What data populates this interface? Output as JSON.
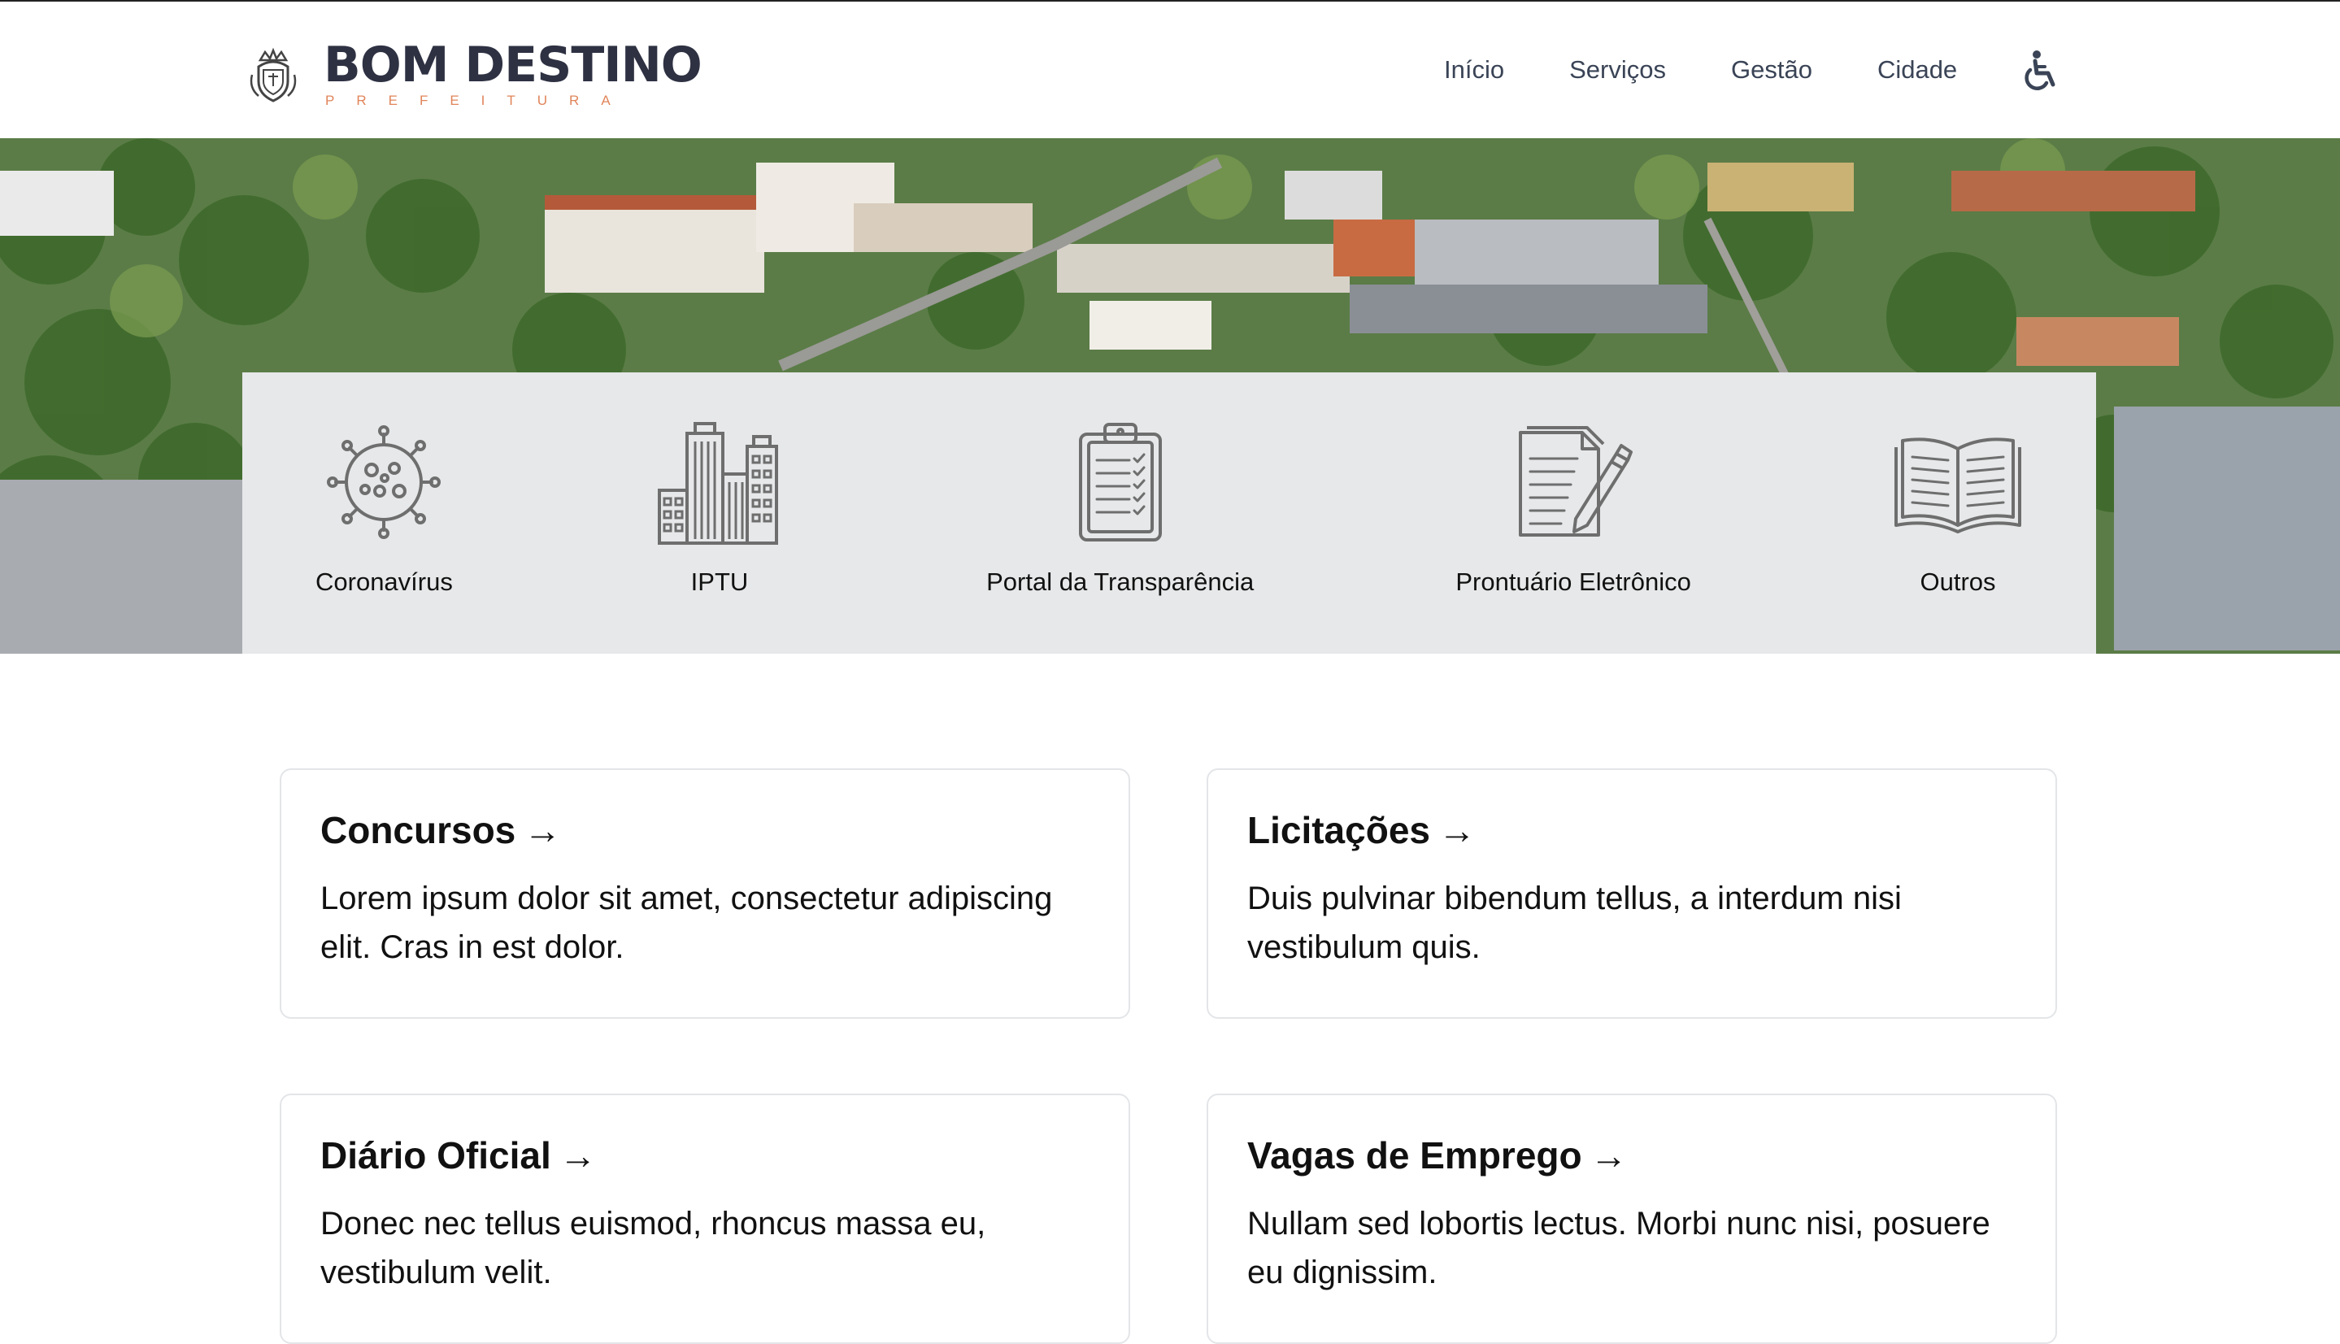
{
  "header": {
    "brand_name": "BOM DESTINO",
    "brand_sub": "PREFEITURA",
    "nav": [
      {
        "label": "Início"
      },
      {
        "label": "Serviços"
      },
      {
        "label": "Gestão"
      },
      {
        "label": "Cidade"
      }
    ],
    "accessibility_icon": "wheelchair-icon",
    "logo_icon": "crest-icon"
  },
  "hero": {
    "image": "aerial-city-photo"
  },
  "services": [
    {
      "label": "Coronavírus",
      "icon": "virus-icon"
    },
    {
      "label": "IPTU",
      "icon": "buildings-icon"
    },
    {
      "label": "Portal da Transparência",
      "icon": "clipboard-checklist-icon"
    },
    {
      "label": "Prontuário Eletrônico",
      "icon": "document-pen-icon"
    },
    {
      "label": "Outros",
      "icon": "open-book-icon"
    }
  ],
  "cards": [
    {
      "title": "Concursos",
      "arrow": "→",
      "text": "Lorem ipsum dolor sit amet, consectetur adipiscing elit. Cras in est dolor."
    },
    {
      "title": "Licitações",
      "arrow": "→",
      "text": "Duis pulvinar bibendum tellus, a interdum nisi vestibulum quis."
    },
    {
      "title": "Diário Oficial",
      "arrow": "→",
      "text": "Donec nec tellus euismod, rhoncus massa eu, vestibulum velit."
    },
    {
      "title": "Vagas de Emprego",
      "arrow": "→",
      "text": "Nullam sed lobortis lectus. Morbi nunc nisi, posuere eu dignissim."
    }
  ],
  "colors": {
    "brand_dark": "#2e3142",
    "brand_accent": "#e0855a",
    "nav_text": "#3a4456",
    "services_bg": "#e6e8e9",
    "icon_gray": "#6e6e6e"
  }
}
